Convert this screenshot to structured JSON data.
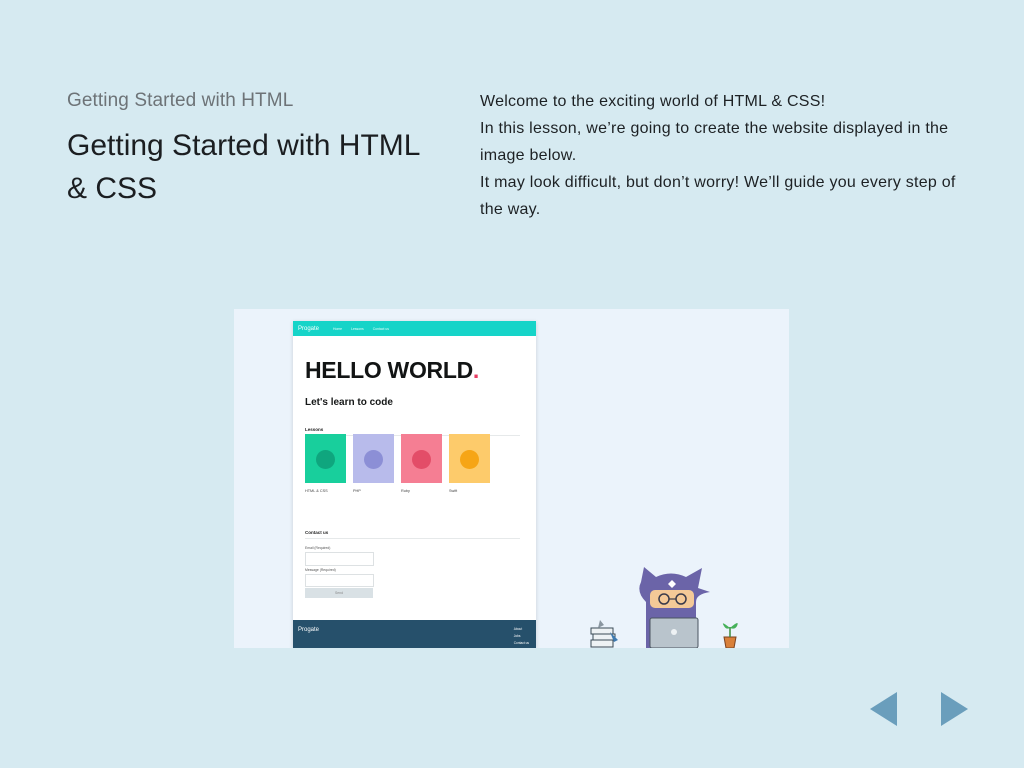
{
  "slide": {
    "subtitle": "Getting Started with HTML",
    "title": "Getting Started with HTML & CSS",
    "intro": [
      "Welcome to the exciting world of HTML & CSS!",
      "In this lesson, we’re going to create the website displayed in the image below.",
      "It may look difficult, but don’t worry! We’ll guide you every step of the way."
    ]
  },
  "preview": {
    "logo": "Progate",
    "nav": [
      "Home",
      "Lessons",
      "Contact us"
    ],
    "hello": "HELLO WORLD",
    "hello_dot": ".",
    "tagline": "Let's learn to code",
    "lessons_heading": "Lessons",
    "lessons": [
      {
        "label": "HTML & CSS",
        "color": "#18cf9c",
        "circle": "#0fa67e"
      },
      {
        "label": "PHP",
        "color": "#b8bbeb",
        "circle": "#8c8fd6"
      },
      {
        "label": "Ruby",
        "color": "#f57e93",
        "circle": "#e34d68"
      },
      {
        "label": "Swift",
        "color": "#fdcb6b",
        "circle": "#f6a516"
      }
    ],
    "contact_heading": "Contact us",
    "email_label": "Email (Required)",
    "message_label": "Message (Required)",
    "required_note": "* Required fields must be filled",
    "send_label": "Send",
    "footer_logo": "Progate",
    "footer_links": [
      "About",
      "Jobs",
      "Contact us"
    ]
  },
  "colors": {
    "background": "#d6eaf1",
    "arrow": "#6a9ebc",
    "header_teal": "#16d4c8",
    "footer_navy": "#26506b"
  },
  "icons": {
    "prev": "triangle-left-icon",
    "next": "triangle-right-icon"
  }
}
